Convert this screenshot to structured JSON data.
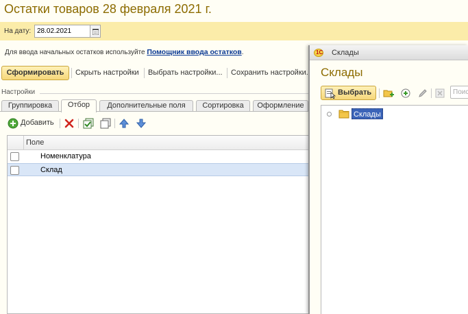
{
  "main": {
    "title": "Остатки товаров 28 февраля 2021 г.",
    "date_label": "На дату:",
    "date_value": "28.02.2021",
    "hint_text": "Для ввода начальных остатков используйте ",
    "hint_link": "Помощник ввода остатков",
    "hint_end": ".",
    "toolbar": {
      "generate": "Сформировать",
      "hide_settings": "Скрыть настройки",
      "select_settings": "Выбрать настройки...",
      "save_settings": "Сохранить настройки..."
    },
    "settings_legend": "Настройки",
    "tabs": [
      {
        "label": "Группировка",
        "active": false
      },
      {
        "label": "Отбор",
        "active": true
      },
      {
        "label": "Дополнительные поля",
        "active": false
      },
      {
        "label": "Сортировка",
        "active": false
      },
      {
        "label": "Оформление",
        "active": false
      }
    ],
    "add_label": "Добавить",
    "grid": {
      "header": "Поле",
      "rows": [
        {
          "label": "Номенклатура",
          "checked": false,
          "selected": false
        },
        {
          "label": "Склад",
          "checked": false,
          "selected": true
        }
      ]
    }
  },
  "dialog": {
    "window_title": "Склады",
    "heading": "Склады",
    "select_label": "Выбрать",
    "search_placeholder": "Поиск",
    "tree": [
      {
        "label": "Склады",
        "selected": true
      }
    ]
  },
  "colors": {
    "title": "#8c6b00",
    "date_band": "#fbeca9",
    "primary_button": "#f6d77a",
    "selection": "#3b64b8",
    "row_highlight": "#d9e6f7",
    "link": "#0b3a94"
  }
}
